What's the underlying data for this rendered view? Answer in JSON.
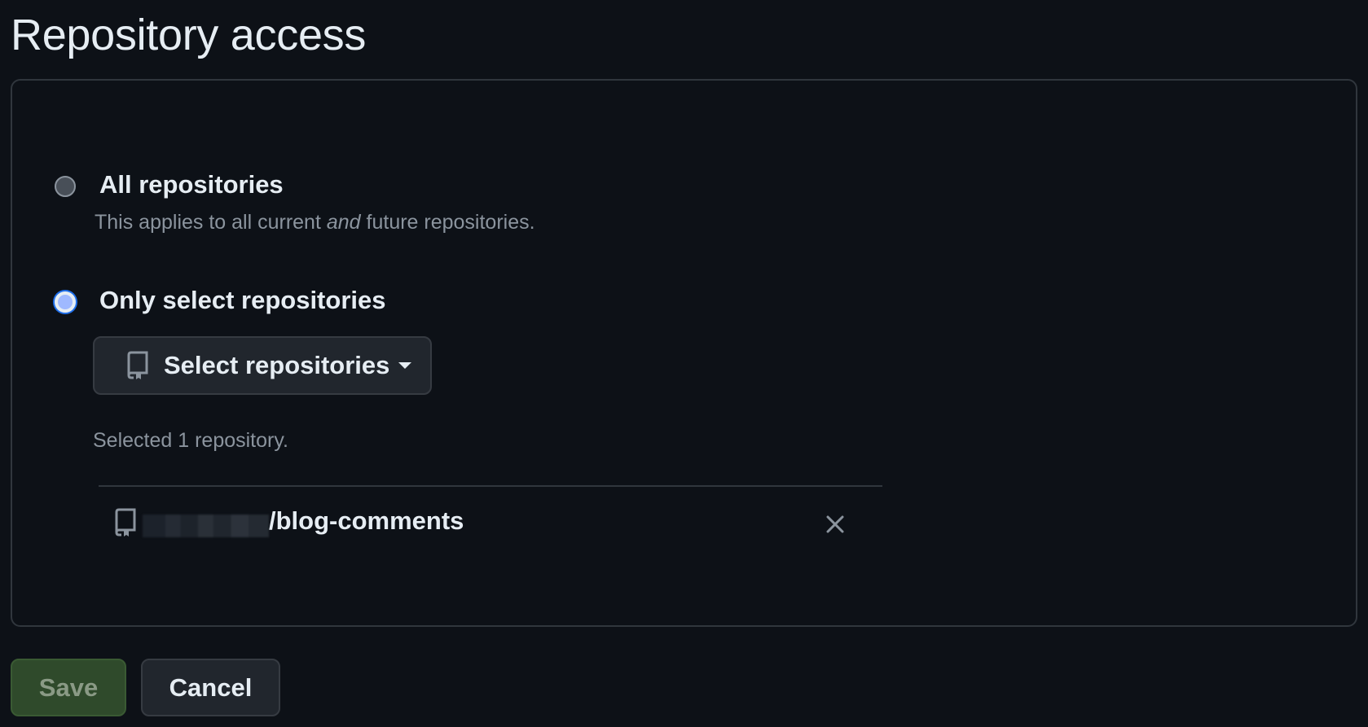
{
  "title": "Repository access",
  "options": {
    "all": {
      "label": "All repositories",
      "desc_before": "This applies to all current ",
      "desc_em": "and",
      "desc_after": " future repositories.",
      "checked": false
    },
    "select": {
      "label": "Only select repositories",
      "checked": true
    }
  },
  "select_button": {
    "label": "Select repositories",
    "icon": "repo-icon",
    "caret": "caret-down-icon"
  },
  "selected_count": "Selected 1 repository.",
  "repositories": [
    {
      "name": "/blog-comments",
      "owner_redacted": true,
      "icon": "repo-icon",
      "remove_icon": "x-icon"
    }
  ],
  "actions": {
    "save": "Save",
    "cancel": "Cancel"
  },
  "colors": {
    "background": "#0d1117",
    "border": "#30363d",
    "text": "#e6edf3",
    "muted": "#8b949e",
    "save_bg": "#2f4a2b",
    "radio_checked": "#9fb9ff"
  }
}
